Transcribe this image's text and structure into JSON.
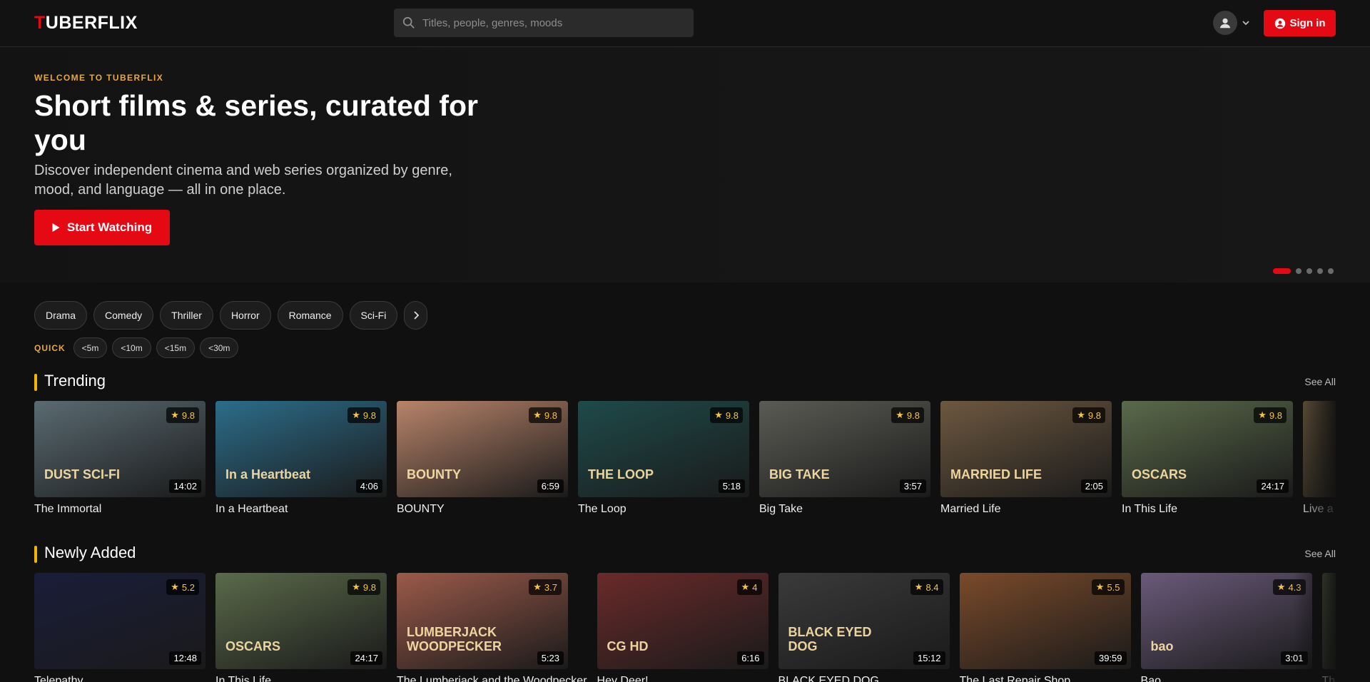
{
  "header": {
    "logo_first": "T",
    "logo_rest": "UBERFLIX",
    "search_placeholder": "Titles, people, genres, moods",
    "signin_label": "Sign in",
    "search_icon": "search-icon",
    "account_icon": "user-icon"
  },
  "hero": {
    "eyebrow": "WELCOME TO TUBERFLIX",
    "title": "Short films & series, curated for you",
    "subtitle": "Discover independent cinema and web series organized by genre, mood, and language — all in one place.",
    "cta_label": "Start Watching",
    "slides": 5,
    "active_slide": 0
  },
  "genres": [
    "Drama",
    "Comedy",
    "Thriller",
    "Horror",
    "Romance",
    "Sci-Fi"
  ],
  "quick": {
    "label": "QUICK",
    "options": [
      "<5m",
      "<10m",
      "<15m",
      "<30m"
    ]
  },
  "trending": {
    "title": "Trending",
    "see_all": "See All",
    "items": [
      {
        "title": "The Immortal",
        "rating": "9.8",
        "duration": "14:02",
        "art": "DUST SCI-FI",
        "bg": "#5a6b72"
      },
      {
        "title": "In a Heartbeat",
        "rating": "9.8",
        "duration": "4:06",
        "art": "In a Heartbeat",
        "bg": "#2c6d8a"
      },
      {
        "title": "BOUNTY",
        "rating": "9.8",
        "duration": "6:59",
        "art": "BOUNTY",
        "bg": "#b8846a"
      },
      {
        "title": "The Loop",
        "rating": "9.8",
        "duration": "5:18",
        "art": "THE LOOP",
        "bg": "#1f4a4a"
      },
      {
        "title": "Big Take",
        "rating": "9.8",
        "duration": "3:57",
        "art": "BIG TAKE",
        "bg": "#5b5b55"
      },
      {
        "title": "Married Life",
        "rating": "9.8",
        "duration": "2:05",
        "art": "MARRIED LIFE",
        "bg": "#6d5840"
      },
      {
        "title": "In This Life",
        "rating": "9.8",
        "duration": "24:17",
        "art": "OSCARS",
        "bg": "#5a6a4a"
      },
      {
        "title": "Live a L",
        "rating": "",
        "duration": "",
        "art": "",
        "bg": "#6b5a3e"
      }
    ]
  },
  "newly_added": {
    "title": "Newly Added",
    "see_all": "See All",
    "items": [
      {
        "title": "Telepathy",
        "rating": "5.2",
        "duration": "12:48",
        "art": "",
        "bg": "#1a1d3a"
      },
      {
        "title": "In This Life",
        "rating": "9.8",
        "duration": "24:17",
        "art": "OSCARS",
        "bg": "#5a6a4a"
      },
      {
        "title": "The Lumberjack and the Woodpecker",
        "rating": "3.7",
        "duration": "5:23",
        "art": "LUMBERJACK WOODPECKER",
        "bg": "#9b5a4a"
      },
      {
        "title": "Hey Deer!",
        "rating": "4",
        "duration": "6:16",
        "art": "CG HD",
        "bg": "#6a2a2a"
      },
      {
        "title": "BLACK EYED DOG",
        "rating": "8.4",
        "duration": "15:12",
        "art": "BLACK EYED DOG",
        "bg": "#3a3a3a"
      },
      {
        "title": "The Last Repair Shop",
        "rating": "5.5",
        "duration": "39:59",
        "art": "",
        "bg": "#7a4a2a"
      },
      {
        "title": "Bao",
        "rating": "4.3",
        "duration": "3:01",
        "art": "bao",
        "bg": "#6a5a7a"
      },
      {
        "title": "The Ph",
        "rating": "",
        "duration": "",
        "art": "",
        "bg": "#5a6a4a"
      }
    ]
  },
  "colors": {
    "brand": "#e50914",
    "accent": "#f5b301",
    "eyebrow": "#e8a83a",
    "background": "#101010"
  }
}
